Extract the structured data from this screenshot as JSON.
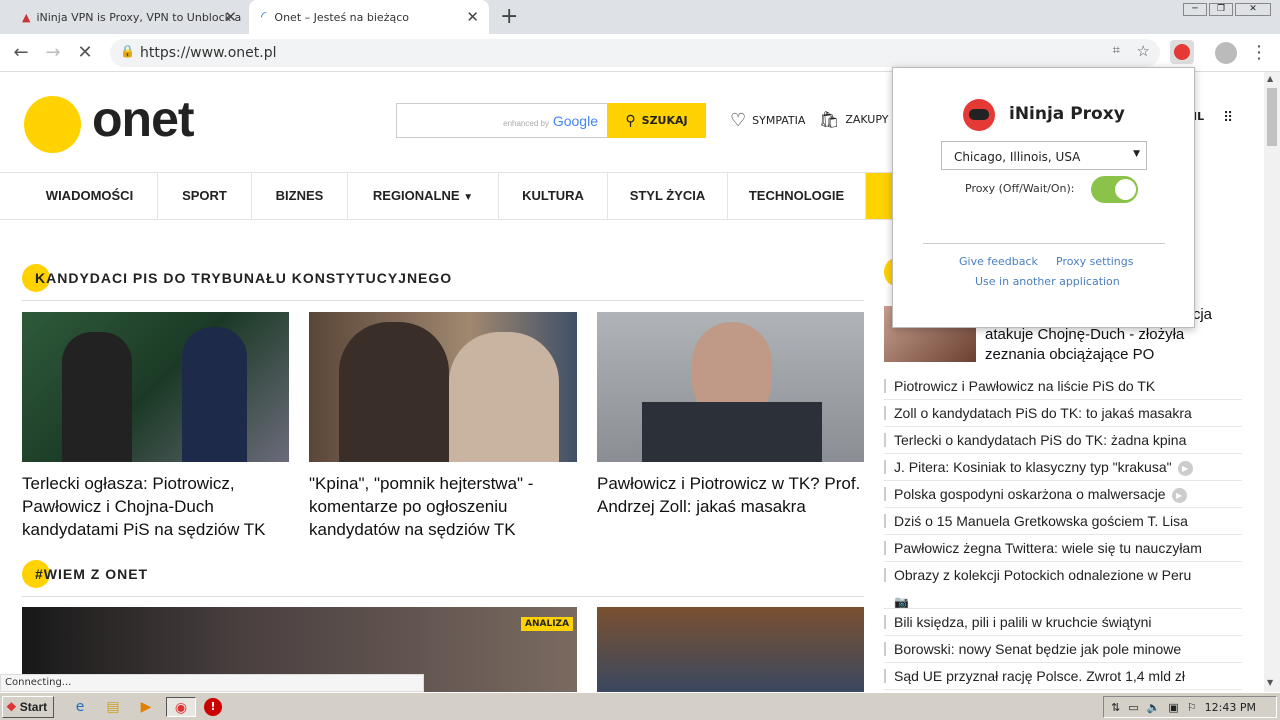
{
  "browser": {
    "tabs": [
      {
        "title": "iNinja VPN is Proxy, VPN to Unblock a"
      },
      {
        "title": "Onet – Jesteś na bieżąco"
      }
    ],
    "url": "https://www.onet.pl",
    "status": "Connecting..."
  },
  "site": {
    "logo": "onet",
    "search": {
      "provider_prefix": "enhanced by",
      "provider": "Google",
      "button": "SZUKAJ"
    },
    "top_links": [
      {
        "label": "SYMPATIA"
      },
      {
        "label": "ZAKUPY"
      },
      {
        "label": "IL"
      }
    ],
    "nav": [
      "WIADOMOŚCI",
      "SPORT",
      "BIZNES",
      "REGIONALNE",
      "KULTURA",
      "STYL ŻYCIA",
      "TECHNOLOGIE"
    ],
    "section1": {
      "title": "KANDYDACI PIS DO TRYBUNAŁU KONSTYTUCYJNEGO",
      "articles": [
        {
          "headline": "Terlecki ogłasza: Piotrowicz, Pawłowicz i Chojna-Duch kandydatami PiS na sędziów TK"
        },
        {
          "headline": "\"Kpina\", \"pomnik hejterstwa\" - komentarze po ogłoszeniu kandydatów na sędziów TK"
        },
        {
          "headline": "Pawłowicz i Piotrowicz w TK? Prof. Andrzej Zoll: jakaś masakra"
        }
      ]
    },
    "section2": {
      "title": "#WIEM Z ONET",
      "badge": "ANALIZA"
    },
    "side": {
      "featured": {
        "line1": "cja",
        "line2": "atakuje Chojnę-Duch - złożyła",
        "line3": "zeznania obciążające PO"
      },
      "items": [
        "Piotrowicz i Pawłowicz na liście PiS do TK",
        "Zoll o kandydatach PiS do TK: to jakaś masakra",
        "Terlecki o kandydatach PiS do TK: żadna kpina",
        "J. Pitera: Kosiniak to klasyczny typ \"krakusa\"",
        "Polska gospodyni oskarżona o malwersacje",
        "Dziś o 15 Manuela Gretkowska gościem T. Lisa",
        "Pawłowicz żegna Twittera: wiele się tu nauczyłam",
        "Obrazy z kolekcji Potockich odnalezione w Peru",
        "Bili księdza, pili i palili w kruchcie świątyni",
        "Borowski: nowy Senat będzie jak pole minowe",
        "Sąd UE przyznał rację Polsce. Zwrot 1,4 mld zł"
      ]
    }
  },
  "popup": {
    "title": "iNinja Proxy",
    "location": "Chicago, Illinois, USA",
    "proxy_label": "Proxy (Off/Wait/On):",
    "proxy_state": "on",
    "links": {
      "feedback": "Give feedback",
      "settings": "Proxy settings",
      "other": "Use in another application"
    }
  },
  "taskbar": {
    "start": "Start",
    "clock": "12:43 PM"
  },
  "colors": {
    "brand": "#ffd200",
    "toggle_on": "#8bc34a",
    "link": "#4a7fc1"
  }
}
